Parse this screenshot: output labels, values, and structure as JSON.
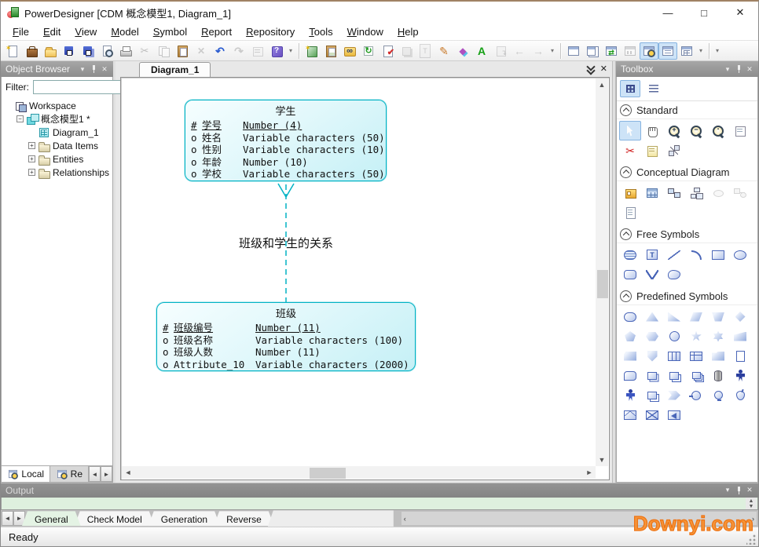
{
  "window": {
    "title": "PowerDesigner [CDM 概念模型1, Diagram_1]",
    "controls": [
      {
        "name": "minimize-button",
        "icon": "minimize-icon",
        "glyph": "—"
      },
      {
        "name": "maximize-button",
        "icon": "maximize-icon",
        "glyph": "□"
      },
      {
        "name": "close-button",
        "icon": "close-icon",
        "glyph": "✕"
      }
    ]
  },
  "menu": {
    "items": [
      {
        "id": "menu-file",
        "label": "File"
      },
      {
        "id": "menu-edit",
        "label": "Edit"
      },
      {
        "id": "menu-view",
        "label": "View"
      },
      {
        "id": "menu-model",
        "label": "Model"
      },
      {
        "id": "menu-symbol",
        "label": "Symbol"
      },
      {
        "id": "menu-report",
        "label": "Report"
      },
      {
        "id": "menu-repository",
        "label": "Repository"
      },
      {
        "id": "menu-tools",
        "label": "Tools"
      },
      {
        "id": "menu-window",
        "label": "Window"
      },
      {
        "id": "menu-help",
        "label": "Help"
      }
    ]
  },
  "toolbar": {
    "group1": [
      {
        "name": "New",
        "icon": "new-document-icon",
        "cls": "i-new"
      },
      {
        "name": "Open Workspace",
        "icon": "open-workspace-icon",
        "cls": "i-workspace"
      },
      {
        "name": "Open",
        "icon": "open-folder-icon",
        "cls": "i-open"
      },
      {
        "name": "Save",
        "icon": "save-icon",
        "cls": "i-save"
      },
      {
        "name": "Save All",
        "icon": "save-all-icon",
        "cls": "i-saveall"
      },
      {
        "name": "Print Preview",
        "icon": "print-preview-icon",
        "cls": "i-preview"
      },
      {
        "name": "Print",
        "icon": "print-icon",
        "cls": "i-print"
      },
      {
        "name": "Cut",
        "icon": "cut-icon",
        "cls": "i-cut",
        "disabled": true
      },
      {
        "name": "Copy",
        "icon": "copy-icon",
        "cls": "i-copy",
        "disabled": true
      },
      {
        "name": "Paste",
        "icon": "paste-icon",
        "cls": "i-paste"
      },
      {
        "name": "Delete",
        "icon": "delete-icon",
        "cls": "i-delete",
        "disabled": true
      },
      {
        "name": "Undo",
        "icon": "undo-icon",
        "cls": "i-undo"
      },
      {
        "name": "Redo",
        "icon": "redo-icon",
        "cls": "i-redo",
        "disabled": true
      },
      {
        "name": "Properties",
        "icon": "properties-icon",
        "cls": "i-props",
        "disabled": true
      },
      {
        "name": "Help",
        "icon": "help-book-icon",
        "cls": "i-help"
      }
    ],
    "group2": [
      {
        "name": "New Model",
        "icon": "new-model-icon",
        "cls": "i-newmodel"
      },
      {
        "name": "Paste As Shortcut",
        "icon": "paste-shortcut-icon",
        "cls": "i-pastesh"
      },
      {
        "name": "Find Objects",
        "icon": "find-objects-icon",
        "cls": "i-find"
      },
      {
        "name": "Refresh Model",
        "icon": "refresh-icon",
        "cls": "i-refresh"
      },
      {
        "name": "Check Model",
        "icon": "check-model-icon",
        "cls": "i-check"
      },
      {
        "name": "Shadow",
        "icon": "shadow-icon",
        "cls": "i-shadow",
        "disabled": true
      },
      {
        "name": "Title Frame",
        "icon": "title-frame-icon",
        "cls": "i-frame",
        "disabled": true
      },
      {
        "name": "Format Pen",
        "icon": "format-pen-icon",
        "cls": "i-pen"
      },
      {
        "name": "Fill Style",
        "icon": "fill-style-icon",
        "cls": "i-fill"
      },
      {
        "name": "Font",
        "icon": "font-icon",
        "cls": "i-font"
      },
      {
        "name": "Send To Back",
        "icon": "send-back-icon",
        "cls": "i-sendback",
        "disabled": true
      },
      {
        "name": "Previous Diagram",
        "icon": "previous-arrow-icon",
        "cls": "i-prev",
        "disabled": true
      },
      {
        "name": "Next Diagram",
        "icon": "next-arrow-icon",
        "cls": "i-next",
        "disabled": true
      }
    ],
    "group3": [
      {
        "name": "New Diagram Window",
        "icon": "diagram-window-icon",
        "cls": "i-win"
      },
      {
        "name": "Tile Windows",
        "icon": "tile-windows-icon",
        "cls": "i-win2"
      },
      {
        "name": "Switch Diagram",
        "icon": "switch-diagram-icon",
        "cls": "i-winswitch"
      },
      {
        "name": "Dependencies Window",
        "icon": "dependencies-window-icon",
        "cls": "i-winlink",
        "disabled": true
      },
      {
        "name": "Browse Window",
        "icon": "browse-window-icon",
        "cls": "i-winzoom",
        "pressed": true
      },
      {
        "name": "Result List Window",
        "icon": "result-list-icon",
        "cls": "i-winnote",
        "pressed": true
      },
      {
        "name": "Grid Window",
        "icon": "grid-window-icon",
        "cls": "i-wingrid"
      }
    ]
  },
  "object_browser": {
    "title": "Object Browser",
    "filter_label": "Filter:",
    "filter_value": "",
    "tree": [
      {
        "label": "Workspace",
        "icon": "g-ws",
        "level": 0,
        "expander": ""
      },
      {
        "label": "概念模型1 *",
        "icon": "g-model",
        "level": 1,
        "expander": "−"
      },
      {
        "label": "Diagram_1",
        "icon": "g-diagram",
        "level": 2,
        "expander": ""
      },
      {
        "label": "Data Items",
        "icon": "g-folder",
        "level": 2,
        "expander": "+"
      },
      {
        "label": "Entities",
        "icon": "g-folder",
        "level": 2,
        "expander": "+"
      },
      {
        "label": "Relationships",
        "icon": "g-folder",
        "level": 2,
        "expander": "+"
      }
    ],
    "tabs": [
      {
        "label": "Local",
        "active": true
      },
      {
        "label": "Re",
        "active": false
      }
    ]
  },
  "document": {
    "tab": "Diagram_1"
  },
  "diagram": {
    "entities": [
      {
        "name": "学生",
        "attributes": [
          {
            "marker": "#",
            "name": "学号",
            "type": "Number (4)",
            "pk": true
          },
          {
            "marker": "o",
            "name": "姓名",
            "type": "Variable characters (50)"
          },
          {
            "marker": "o",
            "name": "性别",
            "type": "Variable characters (10)"
          },
          {
            "marker": "o",
            "name": "年龄",
            "type": "Number (10)"
          },
          {
            "marker": "o",
            "name": "学校",
            "type": "Variable characters (50)"
          }
        ]
      },
      {
        "name": "班级",
        "attributes": [
          {
            "marker": "#",
            "name": "班级编号",
            "type": "Number (11)",
            "pk": true
          },
          {
            "marker": "o",
            "name": "班级名称",
            "type": "Variable characters (100)"
          },
          {
            "marker": "o",
            "name": "班级人数",
            "type": "Number (11)"
          },
          {
            "marker": "o",
            "name": "Attribute_10",
            "type": "Variable characters (2000)"
          }
        ]
      }
    ],
    "relationship": {
      "label": "班级和学生的关系",
      "color": "#00b2c4"
    }
  },
  "toolbox": {
    "title": "Toolbox",
    "sections": [
      {
        "label": "Standard",
        "icons": [
          {
            "name": "Pointer",
            "icon": "pointer-icon",
            "cls": "i-pointer",
            "selected": true
          },
          {
            "name": "Grabber",
            "icon": "grabber-hand-icon",
            "cls": "i-hand"
          },
          {
            "name": "Zoom In",
            "icon": "zoom-in-icon",
            "cls": "i-zoomin"
          },
          {
            "name": "Zoom Out",
            "icon": "zoom-out-icon",
            "cls": "i-zoomout"
          },
          {
            "name": "Zoom Window",
            "icon": "zoom-window-icon",
            "cls": "i-zoomwin"
          },
          {
            "name": "Properties",
            "icon": "properties-form-icon",
            "cls": "i-propsform"
          },
          {
            "name": "Delete",
            "icon": "delete-scissors-icon",
            "cls": "i-deltool"
          },
          {
            "name": "Open Diagram",
            "icon": "open-diagram-icon",
            "cls": "i-doc"
          },
          {
            "name": "Link Objects",
            "icon": "link-objects-icon",
            "cls": "i-linktool"
          }
        ]
      },
      {
        "label": "Conceptual Diagram",
        "icons": [
          {
            "name": "Package",
            "icon": "package-icon",
            "cls": "i-package"
          },
          {
            "name": "Entity",
            "icon": "entity-icon",
            "cls": "i-entitytool"
          },
          {
            "name": "Relationship",
            "icon": "relationship-icon",
            "cls": "i-rel"
          },
          {
            "name": "Inheritance",
            "icon": "inheritance-icon",
            "cls": "i-inherit"
          },
          {
            "name": "Association",
            "icon": "association-icon",
            "cls": "i-assoc",
            "disabled": true
          },
          {
            "name": "Association Link",
            "icon": "association-link-icon",
            "cls": "i-assoclink",
            "disabled": true
          },
          {
            "name": "File",
            "icon": "file-icon",
            "cls": "i-filetool"
          }
        ]
      },
      {
        "label": "Free Symbols",
        "icons": [
          {
            "name": "Note",
            "icon": "note-symbol-icon",
            "cls": "s-lines",
            "shape": true
          },
          {
            "name": "Text",
            "icon": "text-symbol-icon",
            "cls": "s-text",
            "shape": true
          },
          {
            "name": "Line",
            "icon": "line-symbol-icon",
            "cls": "s-line",
            "shape": true
          },
          {
            "name": "Arc",
            "icon": "arc-symbol-icon",
            "cls": "s-arc",
            "shape": true
          },
          {
            "name": "Rectangle",
            "icon": "rectangle-symbol-icon",
            "cls": "s-rect",
            "shape": true
          },
          {
            "name": "Ellipse",
            "icon": "ellipse-symbol-icon",
            "cls": "s-ellipse",
            "shape": true
          },
          {
            "name": "Rounded Rectangle",
            "icon": "rounded-rectangle-symbol-icon",
            "cls": "s-roundrect",
            "shape": true
          },
          {
            "name": "Polyline",
            "icon": "polyline-symbol-icon",
            "cls": "s-zigzag",
            "shape": true
          },
          {
            "name": "Polygon",
            "icon": "polygon-symbol-icon",
            "cls": "s-freeform",
            "shape": true
          }
        ]
      },
      {
        "label": "Predefined Symbols",
        "icons": [
          {
            "name": "Rounded Rectangle",
            "icon": "pill-symbol-icon",
            "cls": "s-pill",
            "shape": true
          },
          {
            "name": "Triangle",
            "icon": "triangle-symbol-icon",
            "cls": "s-triangle",
            "shape": true,
            "clip": true
          },
          {
            "name": "Right Triangle",
            "icon": "right-triangle-symbol-icon",
            "cls": "s-rtriangle",
            "shape": true,
            "clip": true
          },
          {
            "name": "Parallelogram",
            "icon": "parallelogram-symbol-icon",
            "cls": "s-para",
            "shape": true,
            "clip": true
          },
          {
            "name": "Trapezoid",
            "icon": "trapezoid-symbol-icon",
            "cls": "s-trap",
            "shape": true,
            "clip": true
          },
          {
            "name": "Diamond",
            "icon": "diamond-symbol-icon",
            "cls": "s-diamond",
            "shape": true,
            "clip": true
          },
          {
            "name": "Pentagon",
            "icon": "pentagon-symbol-icon",
            "cls": "s-pentagon",
            "shape": true,
            "clip": true
          },
          {
            "name": "Hexagon",
            "icon": "hexagon-symbol-icon",
            "cls": "s-hexagon",
            "shape": true,
            "clip": true
          },
          {
            "name": "Circle",
            "icon": "circle-symbol-icon",
            "cls": "s-circle",
            "shape": true
          },
          {
            "name": "Star 5",
            "icon": "star5-symbol-icon",
            "cls": "s-star5",
            "shape": true,
            "clip": true
          },
          {
            "name": "Star 6",
            "icon": "star6-symbol-icon",
            "cls": "s-star6",
            "shape": true,
            "clip": true
          },
          {
            "name": "Banner",
            "icon": "banner-symbol-icon",
            "cls": "s-flag",
            "shape": true,
            "clip": true
          },
          {
            "name": "Cut Corner Rectangle",
            "icon": "cut-corner-rectangle-symbol-icon",
            "cls": "s-cutrect",
            "shape": true,
            "clip": true
          },
          {
            "name": "Shield",
            "icon": "shield-symbol-icon",
            "cls": "s-shield",
            "shape": true,
            "clip": true
          },
          {
            "name": "Split Rectangle",
            "icon": "split-rectangle-symbol-icon",
            "cls": "s-split",
            "shape": true
          },
          {
            "name": "Header Rectangle",
            "icon": "header-rectangle-symbol-icon",
            "cls": "s-header",
            "shape": true
          },
          {
            "name": "Folder",
            "icon": "folder-symbol-icon",
            "cls": "s-foldershape",
            "shape": true,
            "clip": true
          },
          {
            "name": "Page",
            "icon": "page-symbol-icon",
            "cls": "s-page",
            "shape": true
          },
          {
            "name": "Callout",
            "icon": "callout-symbol-icon",
            "cls": "s-callout",
            "shape": true
          },
          {
            "name": "Stacked Pages",
            "icon": "stacked-pages-symbol-icon",
            "cls": "s-stackpages",
            "shape": true
          },
          {
            "name": "Stacked Rectangle",
            "icon": "stacked-rectangle-symbol-icon",
            "cls": "s-stack",
            "shape": true
          },
          {
            "name": "Multiple Rectangles",
            "icon": "multiple-rectangles-symbol-icon",
            "cls": "s-multistack",
            "shape": true
          },
          {
            "name": "Cylinder",
            "icon": "cylinder-symbol-icon",
            "cls": "s-cylinder",
            "shape": true
          },
          {
            "name": "Actor",
            "icon": "actor-symbol-icon",
            "cls": "s-person",
            "shape": true
          },
          {
            "name": "Actor Outline",
            "icon": "actor-outline-symbol-icon",
            "cls": "s-person2",
            "shape": true
          },
          {
            "name": "Double Rectangle",
            "icon": "double-rectangle-symbol-icon",
            "cls": "s-doublerect",
            "shape": true
          },
          {
            "name": "Chevron",
            "icon": "chevron-symbol-icon",
            "cls": "s-chevron",
            "shape": true,
            "clip": true
          },
          {
            "name": "Key Circle",
            "icon": "key-circle-symbol-icon",
            "cls": "s-keycircle",
            "shape": true
          },
          {
            "name": "Balloon",
            "icon": "balloon-symbol-icon",
            "cls": "s-balloon",
            "shape": true
          },
          {
            "name": "Spinner",
            "icon": "spinner-symbol-icon",
            "cls": "s-drop",
            "shape": true
          },
          {
            "name": "Envelope",
            "icon": "envelope-symbol-icon",
            "cls": "s-envelope",
            "shape": true
          },
          {
            "name": "Crossed Box",
            "icon": "crossed-box-symbol-icon",
            "cls": "s-boxx",
            "shape": true
          },
          {
            "name": "Tagged Box",
            "icon": "tagged-box-symbol-icon",
            "cls": "s-boxarrow",
            "shape": true
          }
        ]
      }
    ]
  },
  "output": {
    "title": "Output",
    "tabs": [
      {
        "label": "General",
        "active": true
      },
      {
        "label": "Check Model"
      },
      {
        "label": "Generation"
      },
      {
        "label": "Reverse"
      }
    ]
  },
  "statusbar": {
    "text": "Ready"
  },
  "watermark": {
    "text": "Downyi.com",
    "color": "#ee7211"
  },
  "colors": {
    "selection": "#cde3f7",
    "entity_border": "#00b2c4",
    "entity_fill": "#d7f5f9",
    "output_bg": "#def0de",
    "panel_header": "#8d8d8d",
    "title_top_edge": "#a08264"
  }
}
